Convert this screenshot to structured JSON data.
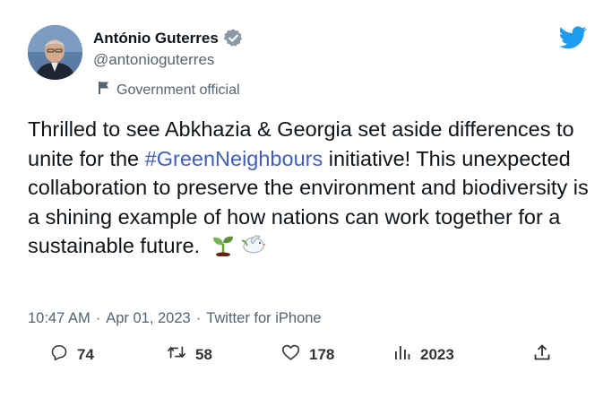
{
  "author": {
    "display_name": "António Guterres",
    "handle": "@antonioguterres",
    "label": "Government official",
    "verified_icon": "verified-badge-icon",
    "avatar_icon": "avatar"
  },
  "tweet": {
    "text_before": "Thrilled to see Abkhazia & Georgia set aside differences to unite for the ",
    "hashtag": "#GreenNeighbours",
    "text_after": " initiative! This unexpected collaboration to preserve the environment and biodiversity is a shining example of how nations can work together for a sustainable future. ",
    "emojis": [
      "seedling-emoji",
      "dove-emoji"
    ]
  },
  "meta": {
    "time": "10:47 AM",
    "separator": "·",
    "date": "Apr 01, 2023",
    "source": "Twitter for iPhone"
  },
  "actions": {
    "replies": "74",
    "retweets": "58",
    "likes": "178",
    "views": "2023"
  },
  "colors": {
    "twitter_blue": "#1d9bf0",
    "hashtag": "#3f5fb8",
    "secondary_text": "#536471",
    "verified_gray": "#8b98a5"
  }
}
